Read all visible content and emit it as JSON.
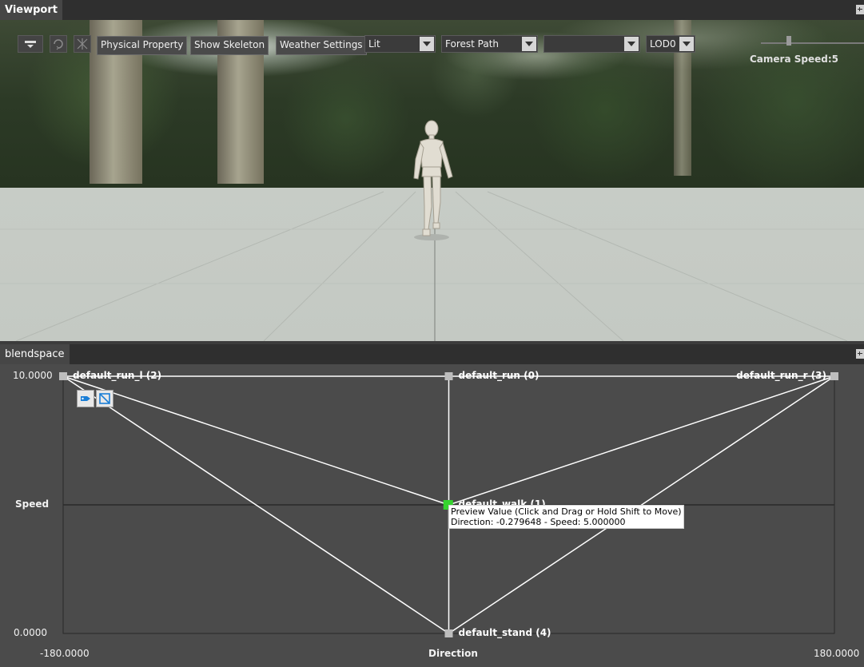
{
  "viewport_tab": {
    "title": "Viewport"
  },
  "toolbar": {
    "physical_property": "Physical Property",
    "show_skeleton": "Show Skeleton",
    "weather_settings": "Weather Settings",
    "view_mode": "Lit",
    "environment": "Forest Path",
    "empty_select": "",
    "lod": "LOD0",
    "camera_speed": "Camera Speed:5"
  },
  "blendspace_tab": {
    "title": "blendspace"
  },
  "blendspace": {
    "y_max": "10.0000",
    "y_min": "0.0000",
    "x_min": "-180.0000",
    "x_max": "180.0000",
    "y_axis_label": "Speed",
    "x_axis_label": "Direction",
    "samples": [
      {
        "label": "default_run_l (2)",
        "direction": -180,
        "speed": 10
      },
      {
        "label": "default_run (0)",
        "direction": 0,
        "speed": 10
      },
      {
        "label": "default_run_r (3)",
        "direction": 180,
        "speed": 10
      },
      {
        "label": "default_walk (1)",
        "direction": 0,
        "speed": 5
      },
      {
        "label": "default_stand (4)",
        "direction": 0,
        "speed": 0
      }
    ],
    "triangles": [
      [
        0,
        1,
        3
      ],
      [
        1,
        2,
        3
      ],
      [
        0,
        3,
        4
      ],
      [
        2,
        3,
        4
      ]
    ],
    "preview": {
      "direction": -0.279648,
      "speed": 5.0,
      "line1": "Preview Value (Click and Drag or Hold Shift to Move)",
      "line2": "Direction: -0.279648 - Speed: 5.000000"
    },
    "colors": {
      "line": "#ffffff",
      "preview": "#35d42e",
      "sample": "#bdbdbd",
      "axis": "#2a2a2a"
    }
  }
}
